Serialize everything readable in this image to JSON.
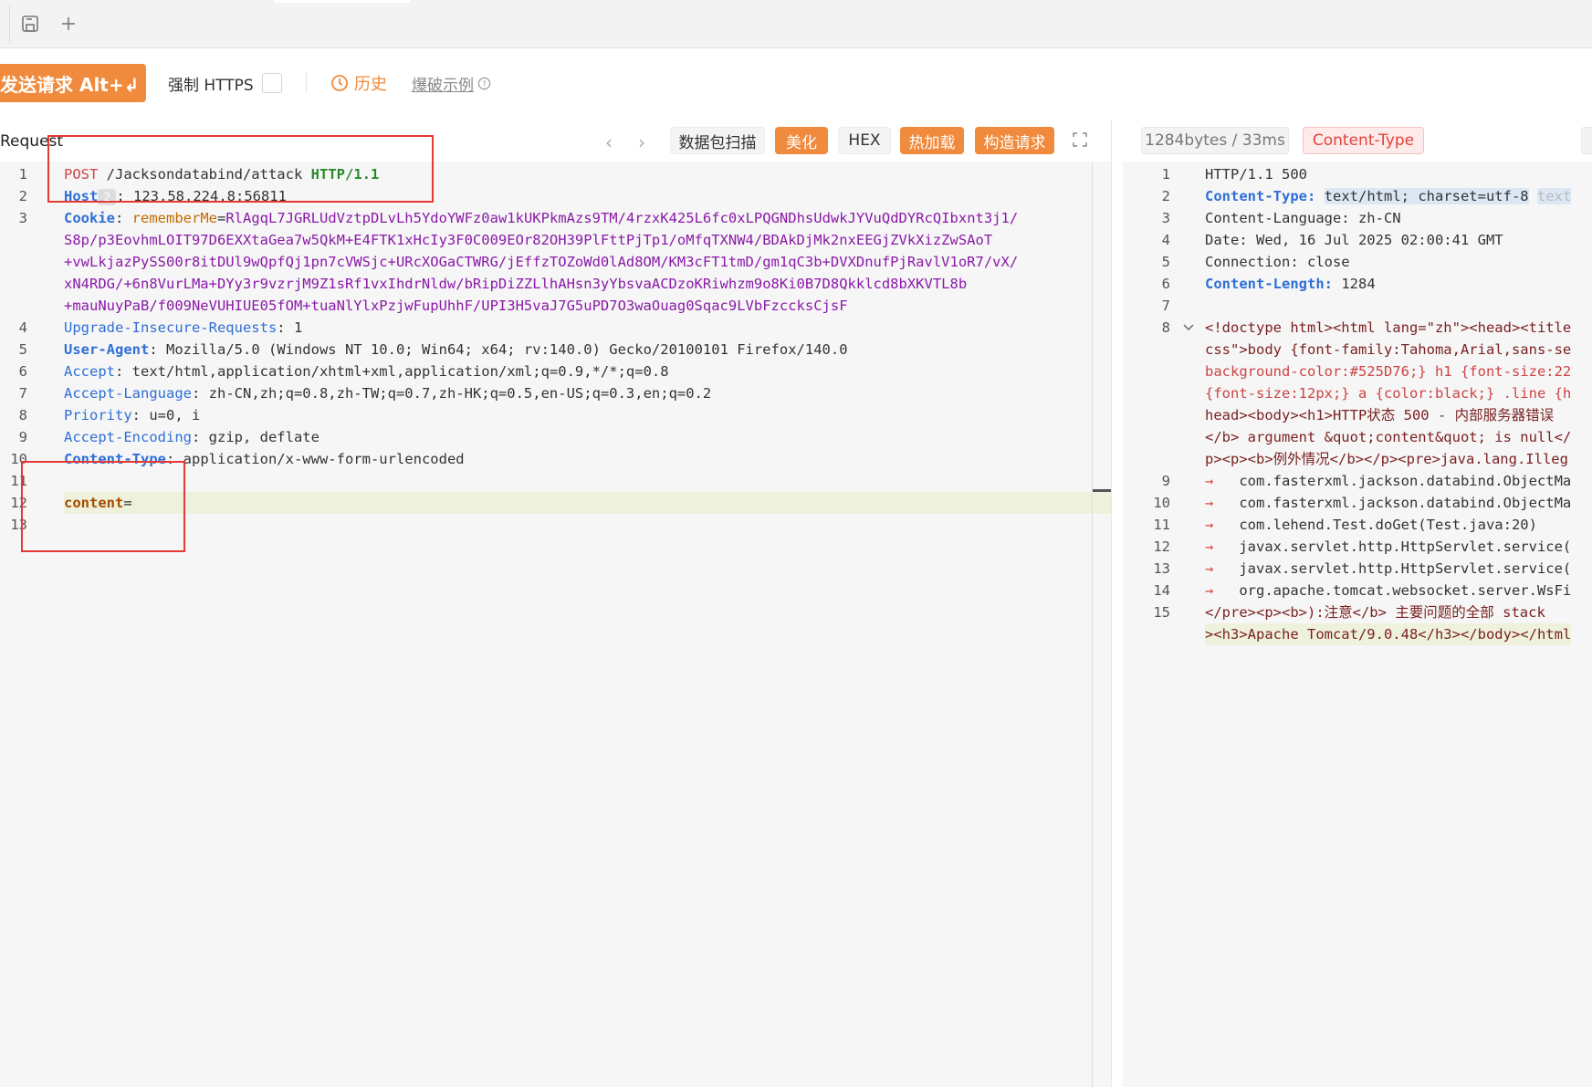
{
  "toolbar": {
    "send_label": "发送请求 Alt+↲",
    "force_https": "强制 HTTPS",
    "history": "历史",
    "brute_example": "爆破示例"
  },
  "request_panel": {
    "title": "Request",
    "btn_scan": "数据包扫描",
    "btn_beautify": "美化",
    "btn_hex": "HEX",
    "btn_hotload": "热加载",
    "btn_construct": "构造请求",
    "lines": {
      "l1_method": "POST",
      "l1_path": "/Jacksondatabind/attack",
      "l1_proto": "HTTP/1.1",
      "l2_key": "Host",
      "l2_badge": "2",
      "l2_val": "123.58.224.8:56811",
      "l3_key": "Cookie",
      "l3_ckey": "rememberMe",
      "l3_a": "RlAgqL7JGRLUdVztpDLvLh5YdoYWFz0aw1kUKPkmAzs9TM/4rzxK425L6fc0xLPQGNDhsUdwkJYVuQdDYRcQIbxnt3j1/",
      "l3_b": "S8p/p3EovhmLOIT97D6EXXtaGea7w5QkM+E4FTK1xHcIy3F0C009EOr82OH39PlFttPjTp1/oMfqTXNW4/BDAkDjMk2nxEEGjZVkXizZwSAoT",
      "l3_c": "+vwLkjazPySS00r8itDUl9wQpfQj1pn7cVWSjc+URcXOGaCTWRG/jEffzTOZoWd0lAd8OM/KM3cFT1tmD/gm1qC3b+DVXDnufPjRavlV1oR7/vX/",
      "l3_d": "xN4RDG/+6n8VurLMa+DYy3r9vzrjM9Z1sRf1vxIhdrNldw/bRipDiZZLlhAHsn3yYbsvaACDzoKRiwhzm9o8Ki0B7D8Qkklcd8bXKVTL8b",
      "l3_e": "+mauNuyPaB/f009NeVUHIUE05fOM+tuaNlYlxPzjwFupUhhF/UPI3H5vaJ7G5uPD7O3waOuag0Sqac9LVbFzccksCjsF",
      "l4_key": "Upgrade-Insecure-Requests",
      "l4_val": "1",
      "l5_key": "User-Agent",
      "l5_val": "Mozilla/5.0 (Windows NT 10.0; Win64; x64; rv:140.0) Gecko/20100101 Firefox/140.0",
      "l6_key": "Accept",
      "l6_val": "text/html,application/xhtml+xml,application/xml;q=0.9,*/*;q=0.8",
      "l7_key": "Accept-Language",
      "l7_val": "zh-CN,zh;q=0.8,zh-TW;q=0.7,zh-HK;q=0.5,en-US;q=0.3,en;q=0.2",
      "l8_key": "Priority",
      "l8_val": "u=0, i",
      "l9_key": "Accept-Encoding",
      "l9_val": "gzip, deflate",
      "l10_key": "Content-Type",
      "l10_val": "application/x-www-form-urlencoded",
      "l12_key": "content",
      "l12_eq": "="
    }
  },
  "response_panel": {
    "size_time": "1284bytes / 33ms",
    "content_type_badge": "Content-Type",
    "lines": {
      "r1": "HTTP/1.1 500",
      "r2_key": "Content-Type:",
      "r2_val": "text/html; charset=utf-8",
      "r2_tail": "text",
      "r3": "Content-Language: zh-CN",
      "r4": "Date: Wed, 16 Jul 2025 02:00:41 GMT",
      "r5": "Connection: close",
      "r6_key": "Content-Length:",
      "r6_val": "1284",
      "r8a": "<!doctype html><html lang=\"zh\"><head><title",
      "r8b": "css\">body {font-family:Tahoma,Arial,sans-se",
      "r8c": "background-color:#525D76;} h1 {font-size:22",
      "r8d": "{font-size:12px;} a {color:black;} .line {h",
      "r8e": "head><body><h1>HTTP状态 500 - 内部服务器错误",
      "r8f": "</b> argument &quot;content&quot; is null</",
      "r8g": "p><p><b>例外情况</b></p><pre>java.lang.Illeg",
      "r9": "com.fasterxml.jackson.databind.ObjectMa",
      "r10": "com.fasterxml.jackson.databind.ObjectMa",
      "r11": "com.lehend.Test.doGet(Test.java:20)",
      "r12": "javax.servlet.http.HttpServlet.service(",
      "r13": "javax.servlet.http.HttpServlet.service(",
      "r14": "org.apache.tomcat.websocket.server.WsFi",
      "r15a": "</pre><p><b>):注意</b> 主要问题的全部 stack ",
      "r15b": "><h3>Apache Tomcat/9.0.48</h3></body></html"
    }
  },
  "line_numbers": [
    "1",
    "2",
    "3",
    "4",
    "5",
    "6",
    "7",
    "8",
    "9",
    "10",
    "11",
    "12",
    "13",
    "14",
    "15"
  ]
}
